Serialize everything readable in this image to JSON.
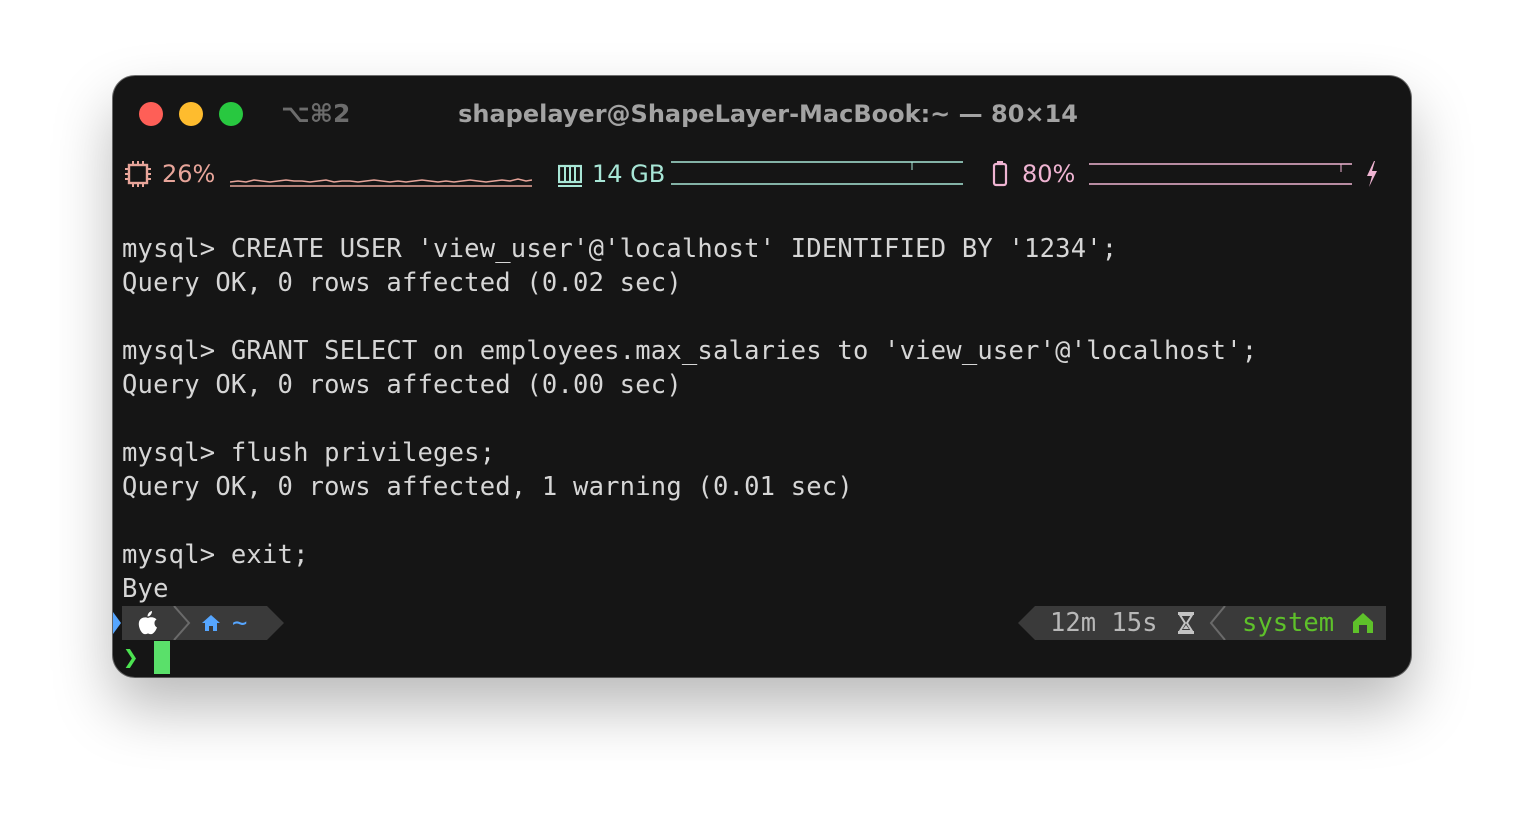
{
  "window": {
    "tab_shortcut": "⌥⌘2",
    "title": "shapelayer@ShapeLayer-MacBook:~ — 80×14"
  },
  "status": {
    "cpu": {
      "value": "26%",
      "icon": "cpu-chip-icon",
      "color": "#e8a59a"
    },
    "memory": {
      "value": "14 GB",
      "icon": "memory-module-icon",
      "color": "#a8e6d6"
    },
    "battery": {
      "value": "80%",
      "icon": "battery-icon",
      "color": "#efb4d2",
      "charging_icon": "lightning-bolt-icon"
    }
  },
  "terminal": {
    "lines": [
      "mysql> CREATE USER 'view_user'@'localhost' IDENTIFIED BY '1234';",
      "Query OK, 0 rows affected (0.02 sec)",
      "",
      "mysql> GRANT SELECT on employees.max_salaries to 'view_user'@'localhost';",
      "Query OK, 0 rows affected (0.00 sec)",
      "",
      "mysql> flush privileges;",
      "Query OK, 0 rows affected, 1 warning (0.01 sec)",
      "",
      "mysql> exit;",
      "Bye"
    ]
  },
  "prompt": {
    "left": {
      "os_icon": "apple-icon",
      "dir_icon": "home-icon",
      "dir": "~"
    },
    "right": {
      "duration": "12m 15s",
      "duration_icon": "hourglass-icon",
      "context": "system",
      "context_icon": "house-icon"
    },
    "chevron": "❯"
  }
}
